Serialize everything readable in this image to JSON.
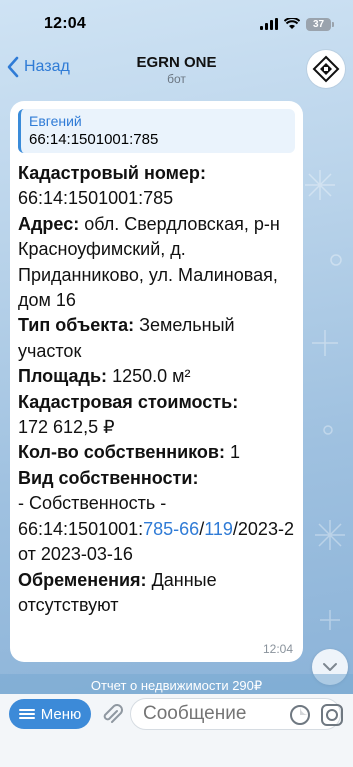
{
  "status": {
    "time": "12:04",
    "battery": "37"
  },
  "nav": {
    "back_label": "Назад",
    "title": "EGRN ONE",
    "subtitle": "бот"
  },
  "message": {
    "reply": {
      "name": "Евгений",
      "text": "66:14:1501001:785"
    },
    "fields": [
      {
        "label": "Кадастровый номер",
        "value": "66:14:1501001:785"
      },
      {
        "label": "Адрес",
        "value": "обл. Свердловская, р-н Красноуфимский, д. Приданниково, ул. Малиновая, дом 16"
      },
      {
        "label": "Тип объекта",
        "value": "Земельный участок"
      },
      {
        "label": "Площадь",
        "value": "1250.0 м²"
      },
      {
        "label": "Кадастровая стоимость",
        "value": "172 612,5 ₽"
      },
      {
        "label": "Кол-во собственников",
        "value": "1"
      },
      {
        "label": "Вид собственности",
        "value_prefix": "- Собственность - 66:14:1501001:",
        "value_link1": "785-66",
        "value_sep": "/",
        "value_link2": "119",
        "value_suffix": "/2023-2 от 2023-03-16"
      },
      {
        "label": "Обременения",
        "value": "Данные отсутствуют"
      }
    ],
    "time": "12:04"
  },
  "report_banner": "Отчет о недвижимости 290₽",
  "input": {
    "menu_label": "Меню",
    "placeholder": "Сообщение"
  },
  "colors": {
    "accent": "#2f7bd6",
    "menu_button": "#3c8ad8"
  }
}
